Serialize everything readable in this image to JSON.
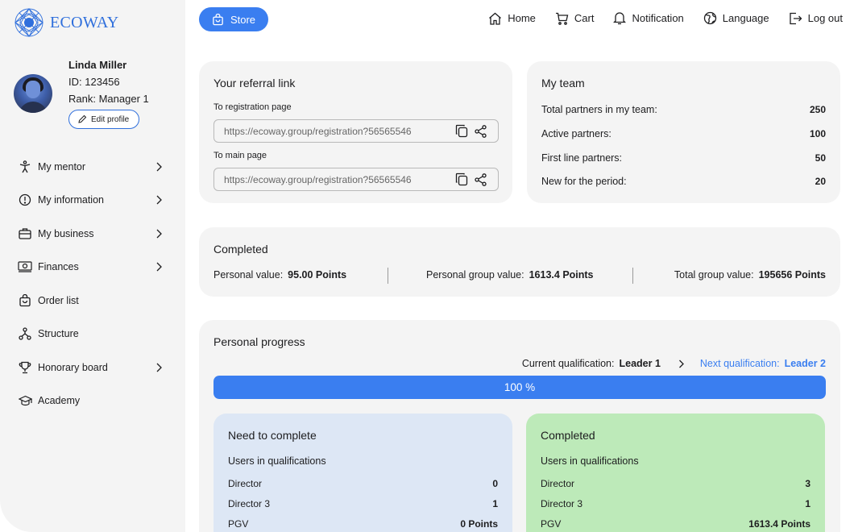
{
  "brand": {
    "name": "ECOWAY",
    "color": "#2f6fdc"
  },
  "profile": {
    "name": "Linda Miller",
    "id_label": "ID:",
    "id_value": "123456",
    "rank_label": "Rank:",
    "rank_value": "Manager 1",
    "edit_label": "Edit profile"
  },
  "sidebar": {
    "items": [
      {
        "label": "My mentor",
        "icon": "person-arms-icon",
        "chevron": true
      },
      {
        "label": "My information",
        "icon": "info-circle-icon",
        "chevron": true
      },
      {
        "label": "My business",
        "icon": "briefcase-icon",
        "chevron": true
      },
      {
        "label": "Finances",
        "icon": "banknote-icon",
        "chevron": true
      },
      {
        "label": "Order list",
        "icon": "shopping-bag-icon",
        "chevron": false
      },
      {
        "label": "Structure",
        "icon": "structure-icon",
        "chevron": false
      },
      {
        "label": "Honorary board",
        "icon": "trophy-icon",
        "chevron": true
      },
      {
        "label": "Academy",
        "icon": "graduation-cap-icon",
        "chevron": false
      }
    ]
  },
  "topbar": {
    "store_label": "Store",
    "nav": [
      {
        "label": "Home",
        "icon": "home-icon"
      },
      {
        "label": "Cart",
        "icon": "cart-icon"
      },
      {
        "label": "Notification",
        "icon": "bell-icon"
      },
      {
        "label": "Language",
        "icon": "globe-icon"
      },
      {
        "label": "Log out",
        "icon": "logout-icon"
      }
    ]
  },
  "referral": {
    "title": "Your referral link",
    "registration_label": "To registration page",
    "registration_link": "https://ecoway.group/registration?56565546",
    "main_label": "To main page",
    "main_link": "https://ecoway.group/registration?56565546"
  },
  "team": {
    "title": "My team",
    "rows": [
      {
        "label": "Total partners in my team:",
        "value": "250"
      },
      {
        "label": "Active partners:",
        "value": "100"
      },
      {
        "label": "First line partners:",
        "value": "50"
      },
      {
        "label": "New for the period:",
        "value": "20"
      }
    ]
  },
  "completed": {
    "title": "Completed",
    "personal_label": "Personal value:",
    "personal_value": "95.00 Points",
    "group_label": "Personal group value:",
    "group_value": "1613.4 Points",
    "total_label": "Total group value:",
    "total_value": "195656 Points"
  },
  "progress": {
    "title": "Personal progress",
    "current_label": "Current qualification:",
    "current_value": "Leader 1",
    "next_label": "Next qualification:",
    "next_value": "Leader 2",
    "percent": 100,
    "percent_text": "100 %",
    "accent": "#3a7ef0"
  },
  "need_to_complete": {
    "title": "Need to complete",
    "subtitle": "Users in qualifications",
    "rows": [
      {
        "label": "Director",
        "value": "0"
      },
      {
        "label": "Director 3",
        "value": "1"
      },
      {
        "label": "PGV",
        "value": "0 Points"
      }
    ]
  },
  "done": {
    "title": "Completed",
    "subtitle": "Users in qualifications",
    "rows": [
      {
        "label": "Director",
        "value": "3"
      },
      {
        "label": "Director 3",
        "value": "1"
      },
      {
        "label": "PGV",
        "value": "1613.4 Points"
      }
    ]
  }
}
